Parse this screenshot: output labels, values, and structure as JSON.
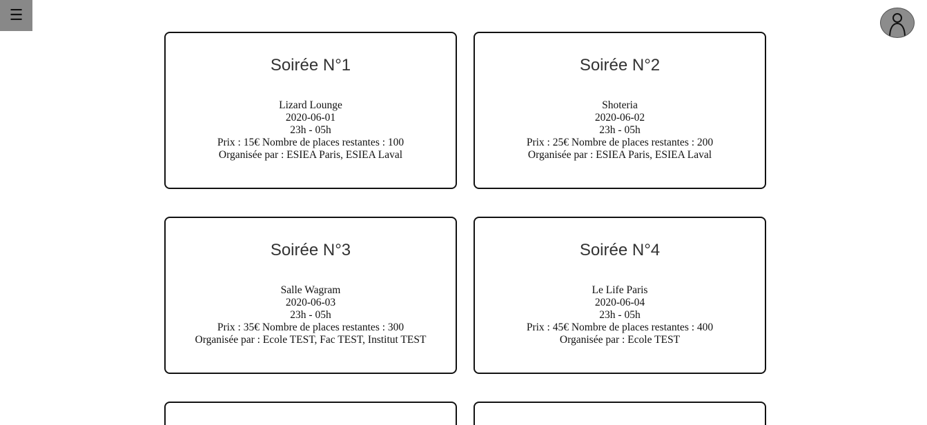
{
  "header": {
    "menu_icon": "☰",
    "avatar_icon": "user-icon"
  },
  "events": [
    {
      "title": "Soirée N°1",
      "venue": "Lizard Lounge",
      "date": "2020-06-01",
      "hours": "23h - 05h",
      "price_line": "Prix : 15€ Nombre de places restantes : 100",
      "organizers": "Organisée par : ESIEA Paris, ESIEA Laval"
    },
    {
      "title": "Soirée N°2",
      "venue": "Shoteria",
      "date": "2020-06-02",
      "hours": "23h - 05h",
      "price_line": "Prix : 25€ Nombre de places restantes : 200",
      "organizers": "Organisée par : ESIEA Paris, ESIEA Laval"
    },
    {
      "title": "Soirée N°3",
      "venue": "Salle Wagram",
      "date": "2020-06-03",
      "hours": "23h - 05h",
      "price_line": "Prix : 35€ Nombre de places restantes : 300",
      "organizers": "Organisée par : Ecole TEST, Fac TEST, Institut TEST"
    },
    {
      "title": "Soirée N°4",
      "venue": "Le Life Paris",
      "date": "2020-06-04",
      "hours": "23h - 05h",
      "price_line": "Prix : 45€ Nombre de places restantes : 400",
      "organizers": "Organisée par : Ecole TEST"
    },
    {
      "title": "",
      "venue": "",
      "date": "",
      "hours": "",
      "price_line": "",
      "organizers": ""
    },
    {
      "title": "",
      "venue": "",
      "date": "",
      "hours": "",
      "price_line": "",
      "organizers": ""
    }
  ]
}
